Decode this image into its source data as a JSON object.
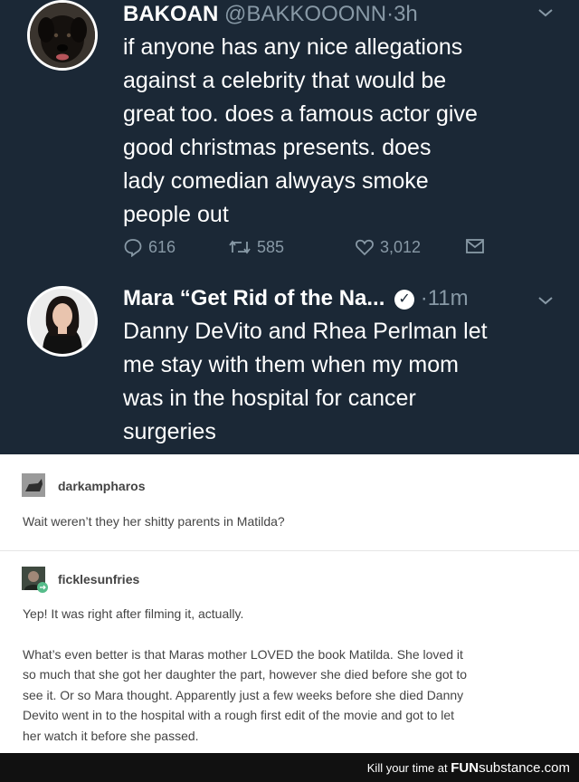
{
  "tweet1": {
    "name": "BAKOAN",
    "handle": "@BAKKOOONN",
    "dot": "·",
    "time": "3h",
    "lines": [
      "if anyone has any nice allegations",
      "against a celebrity that would be",
      "great too. does a famous actor give",
      "good christmas presents. does",
      "lady comedian alwyays smoke",
      "people out"
    ],
    "replies": "616",
    "retweets": "585",
    "likes": "3,012"
  },
  "tweet2": {
    "name": "Mara “Get Rid of the Na...",
    "dot": "·",
    "time": "11m",
    "lines": [
      "Danny DeVito and Rhea Perlman let",
      "me stay with them when my mom",
      "was in the hospital for cancer",
      "surgeries"
    ]
  },
  "post1": {
    "username": "darkampharos",
    "text": "Wait weren’t they her shitty parents in Matilda?"
  },
  "post2": {
    "username": "ficklesunfries",
    "text": "Yep! It was right after filming it, actually.",
    "lines": [
      "What’s even better is that Maras mother LOVED the book Matilda. She loved it",
      "so much that she got her daughter the part, however she died before she got to",
      "see it. Or so Mara thought. Apparently just a few weeks before she died Danny",
      "Devito went in to the hospital with a rough first edit of the movie and got to let",
      "her watch it before she passed."
    ]
  },
  "footer": {
    "text": "Kill your time at",
    "brand_bold": "FUN",
    "brand_rest": "substance",
    "brand_tld": ".com"
  },
  "colors": {
    "twitter_bg": "#1b2836",
    "twitter_meta": "#8899a6",
    "tumblr_text": "#444444"
  }
}
